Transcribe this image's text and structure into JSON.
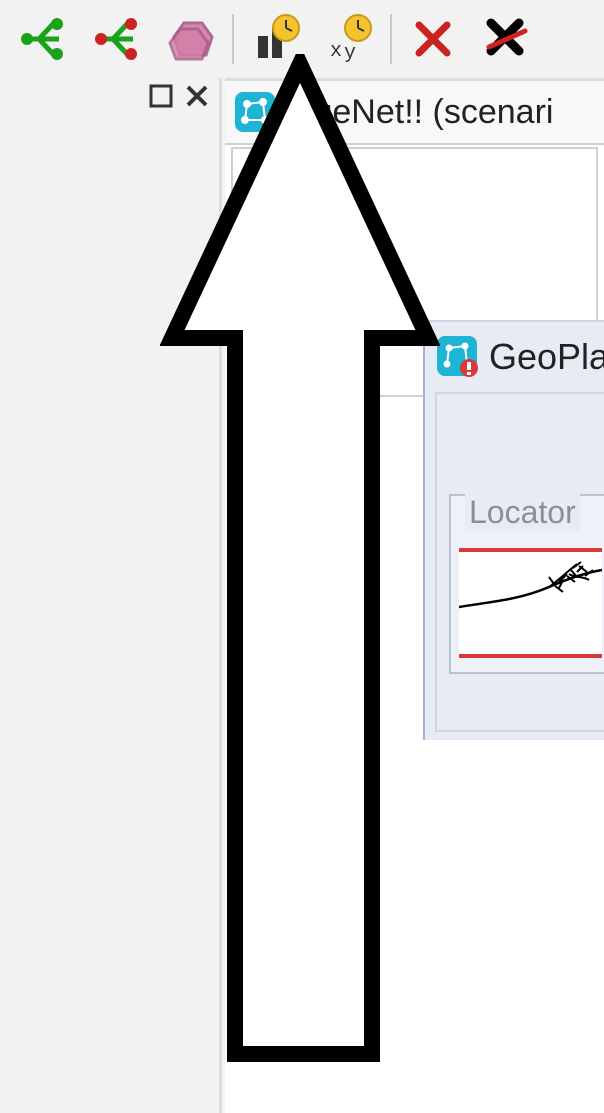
{
  "toolbar": {
    "buttons": [
      {
        "name": "add-node-green-icon",
        "tooltip": "Create node"
      },
      {
        "name": "delete-node-red-icon",
        "tooltip": "Remove node"
      },
      {
        "name": "storage-region-icon",
        "tooltip": "Add storage"
      },
      {
        "name": "run-now-icon",
        "tooltip": "Run simulation now"
      },
      {
        "name": "run-point-icon",
        "tooltip": "Run at point"
      },
      {
        "name": "cancel-icon",
        "tooltip": "Cancel"
      },
      {
        "name": "cancel-all-icon",
        "tooltip": "Cancel all"
      }
    ]
  },
  "left_panel": {
    "maximize_label": "",
    "close_label": ""
  },
  "document": {
    "title_visible": "idgeNet!! (scenari"
  },
  "geopla": {
    "title_visible": "GeoPla",
    "locator_label": "Locator"
  },
  "colors": {
    "accent_blue": "#1eb4d4",
    "warning_yellow": "#f4c430",
    "danger_red": "#d83a3a",
    "btn_red": "#cc2222",
    "btn_green": "#1aa31a",
    "btn_pink": "#d47fa8"
  }
}
